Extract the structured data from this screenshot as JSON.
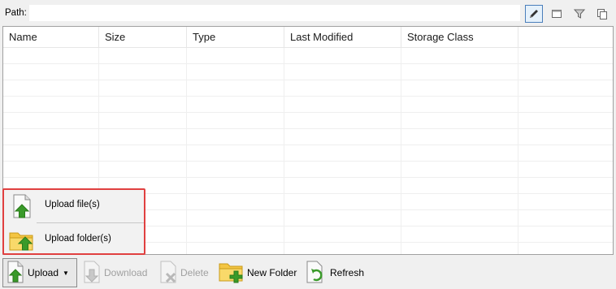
{
  "pathbar": {
    "label": "Path:",
    "value": ""
  },
  "toolbar_icons": [
    {
      "name": "pencil-icon",
      "active": true
    },
    {
      "name": "window-icon",
      "active": false
    },
    {
      "name": "filter-icon",
      "active": false
    },
    {
      "name": "copy-icon",
      "active": false
    }
  ],
  "table": {
    "columns": [
      "Name",
      "Size",
      "Type",
      "Last Modified",
      "Storage Class",
      ""
    ],
    "rows": []
  },
  "upload_menu": {
    "items": [
      {
        "label": "Upload file(s)",
        "icon": "file-upload-icon"
      },
      {
        "label": "Upload folder(s)",
        "icon": "folder-upload-icon"
      }
    ]
  },
  "bottombar": {
    "upload": "Upload",
    "download": "Download",
    "delete": "Delete",
    "new_folder": "New Folder",
    "refresh": "Refresh"
  },
  "colors": {
    "highlight": "#e04040",
    "folder": "#f4c542",
    "arrow_green": "#3a9a2a"
  }
}
